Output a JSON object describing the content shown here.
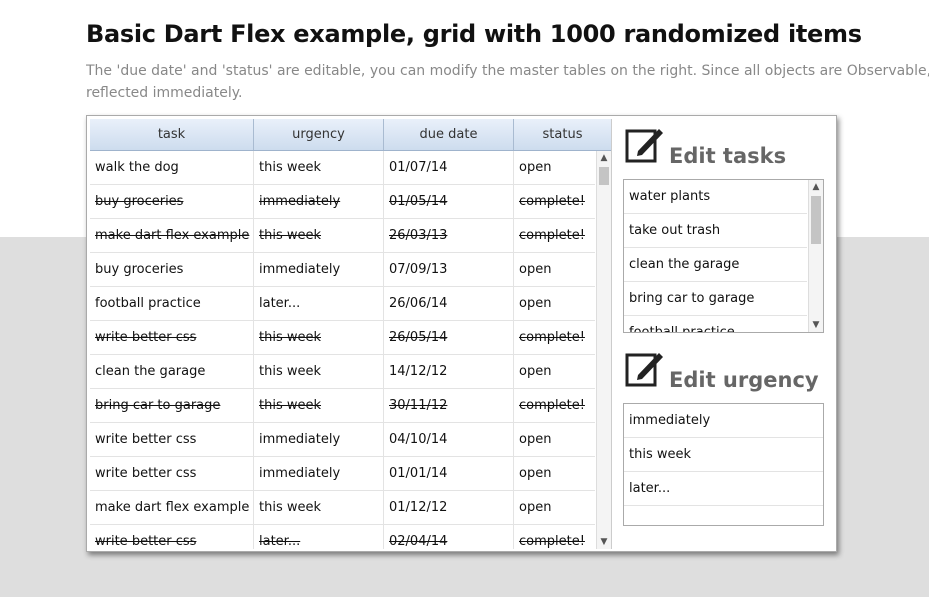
{
  "page": {
    "title": "Basic Dart Flex example, grid with 1000 randomized items",
    "description_line1": "The 'due date' and 'status' are editable, you can modify the master tables on the right. Since all objects are Observable, changes",
    "description_line2": "reflected immediately."
  },
  "grid": {
    "columns": [
      "task",
      "urgency",
      "due date",
      "status"
    ],
    "rows": [
      {
        "task": "walk the dog",
        "urgency": "this week",
        "due": "01/07/14",
        "status": "open",
        "done": false
      },
      {
        "task": "buy groceries",
        "urgency": "immediately",
        "due": "01/05/14",
        "status": "complete!",
        "done": true
      },
      {
        "task": "make dart flex example",
        "urgency": "this week",
        "due": "26/03/13",
        "status": "complete!",
        "done": true
      },
      {
        "task": "buy groceries",
        "urgency": "immediately",
        "due": "07/09/13",
        "status": "open",
        "done": false
      },
      {
        "task": "football practice",
        "urgency": "later...",
        "due": "26/06/14",
        "status": "open",
        "done": false
      },
      {
        "task": "write better css",
        "urgency": "this week",
        "due": "26/05/14",
        "status": "complete!",
        "done": true
      },
      {
        "task": "clean the garage",
        "urgency": "this week",
        "due": "14/12/12",
        "status": "open",
        "done": false
      },
      {
        "task": "bring car to garage",
        "urgency": "this week",
        "due": "30/11/12",
        "status": "complete!",
        "done": true
      },
      {
        "task": "write better css",
        "urgency": "immediately",
        "due": "04/10/14",
        "status": "open",
        "done": false
      },
      {
        "task": "write better css",
        "urgency": "immediately",
        "due": "01/01/14",
        "status": "open",
        "done": false
      },
      {
        "task": "make dart flex example",
        "urgency": "this week",
        "due": "01/12/12",
        "status": "open",
        "done": false
      },
      {
        "task": "write better css",
        "urgency": "later...",
        "due": "02/04/14",
        "status": "complete!",
        "done": true
      }
    ]
  },
  "edit_tasks": {
    "title": "Edit tasks",
    "icon": "edit-icon",
    "items": [
      "water plants",
      "take out trash",
      "clean the garage",
      "bring car to garage",
      "football practice"
    ]
  },
  "edit_urgency": {
    "title": "Edit urgency",
    "icon": "edit-icon",
    "items": [
      "immediately",
      "this week",
      "later..."
    ]
  },
  "colors": {
    "header_bg": "#d9e5f4",
    "band_bg": "#dedede",
    "panel_title": "#666666"
  }
}
